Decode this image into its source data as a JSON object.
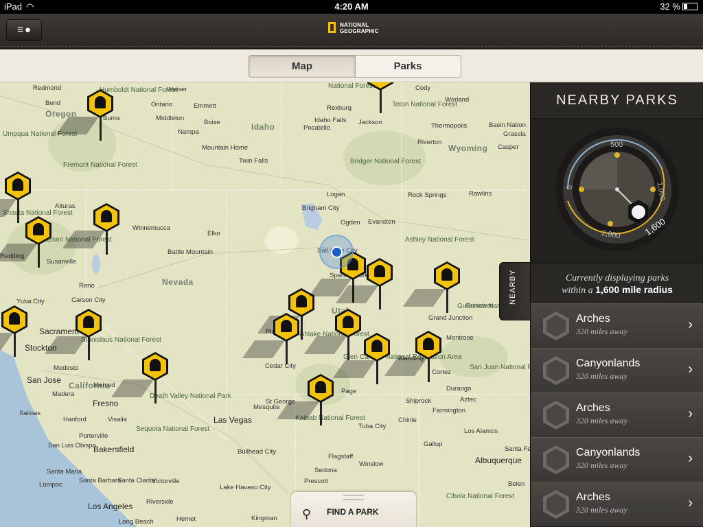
{
  "status_bar": {
    "device": "iPad",
    "time": "4:20 AM",
    "battery": "32 %"
  },
  "nav": {
    "logo_line1": "NATIONAL",
    "logo_line2": "GEOGRAPHIC"
  },
  "segment": {
    "map_label": "Map",
    "parks_label": "Parks",
    "selected": "Map"
  },
  "map": {
    "states": [
      "Oregon",
      "Idaho",
      "Wyoming",
      "Nevada",
      "California",
      "Utah"
    ],
    "cities": [
      "Redmond",
      "Bend",
      "Burns",
      "Ontario",
      "Weiser",
      "Emmett",
      "Middleton",
      "Boise",
      "Nampa",
      "Mountain Home",
      "Twin Falls",
      "Pocatello",
      "Idaho Falls",
      "Rexburg",
      "Jackson",
      "Cody",
      "Worland",
      "Thermopolis",
      "Riverton",
      "Casper",
      "Basin Nation",
      "Grassla",
      "Logan",
      "Brigham City",
      "Ogden",
      "Evanston",
      "Salt Lake City",
      "Rock Springs",
      "Rawlins",
      "Winnemucca",
      "Elko",
      "Battle Mountain",
      "Alturas",
      "Susanville",
      "Redding",
      "Reno",
      "Carson City",
      "Yuba City",
      "Sacrament",
      "Stockton",
      "Modesto",
      "San Jose",
      "Merced",
      "Madera",
      "Fresno",
      "Visalia",
      "Hanford",
      "Porterville",
      "Bakersfield",
      "Salinas",
      "San Luis Obispo",
      "Santa Maria",
      "Lompoc",
      "Santa Barbara",
      "Santa Clarita",
      "Victorville",
      "Los Angeles",
      "Long Beach",
      "Riverside",
      "Hemet",
      "Las Vegas",
      "Mesquite",
      "St George",
      "Cedar City",
      "Page",
      "Bullhead City",
      "Lake Havasu City",
      "Kingman",
      "Prescott",
      "Sedona",
      "Flagstaff",
      "Winslow",
      "Gallup",
      "Farmington",
      "Aztec",
      "Shiprock",
      "Durango",
      "Cortez",
      "Blanding",
      "Montrose",
      "Gunnison",
      "Grand Junction",
      "Tuba City",
      "Chinle",
      "Los Alamos",
      "Santa Fe",
      "Albuquerque",
      "Belen",
      "Spanish Fork",
      "Pioche"
    ],
    "parks": [
      "National Forest",
      "Teton National Forest",
      "Bridger National Forest",
      "Ashley National Forest",
      "Fremont National Forest",
      "Umpqua National Forest",
      "Shasta National Forest",
      "Lassen National Forest",
      "Stanislaus National Forest",
      "Sequoia National Forest",
      "Death Valley National Park",
      "Fishlake National Forest",
      "Glen Canyon National Recreation Area",
      "Kaibab National Forest",
      "Gunnison National Forest",
      "San Juan National Forest",
      "Cibola National Forest",
      "Humboldt National Forest"
    ],
    "find_park_label": "FIND A PARK"
  },
  "nearby_tab_label": "NEARBY",
  "panel": {
    "title": "NEARBY PARKS",
    "dial_labels": [
      "0",
      "500",
      "1,000",
      "2,000",
      "1,600"
    ],
    "radius_prefix": "Currently displaying parks",
    "radius_mid": "within a",
    "radius_value": "1,600 mile radius",
    "parks": [
      {
        "name": "Arches",
        "distance": "320 miles away"
      },
      {
        "name": "Canyonlands",
        "distance": "320 miles away"
      },
      {
        "name": "Arches",
        "distance": "320 miles away"
      },
      {
        "name": "Canyonlands",
        "distance": "320 miles away"
      },
      {
        "name": "Arches",
        "distance": "320 miles away"
      }
    ]
  }
}
